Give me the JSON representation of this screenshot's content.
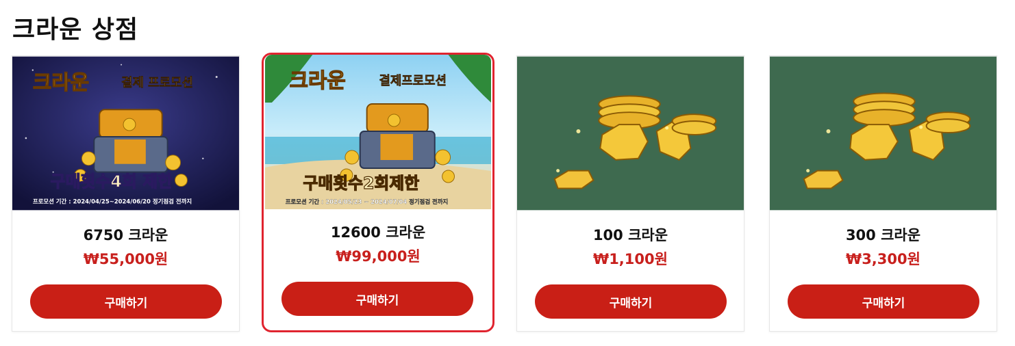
{
  "page": {
    "title": "크라운 상점"
  },
  "products": [
    {
      "name": "6750 크라운",
      "price": "₩55,000원",
      "buy_label": "구매하기",
      "banner": {
        "headline_a": "크라운",
        "headline_b": "결제 프로모션",
        "limit_text": "구매횟수4회 제한",
        "period": "프로모션 기간 : 2024/04/25~2024/06/20 정기점검 전까지",
        "theme": "night"
      }
    },
    {
      "name": "12600 크라운",
      "price": "₩99,000원",
      "buy_label": "구매하기",
      "selected": true,
      "banner": {
        "headline_a": "크라운",
        "headline_b": "결제프로모션",
        "limit_text": "구매횟수2회제한",
        "period": "프로모션 기간 : 2024/05/23 ~ 2024/07/04 정기점검 전까지",
        "theme": "beach"
      }
    },
    {
      "name": "100 크라운",
      "price": "₩1,100원",
      "buy_label": "구매하기",
      "banner": {
        "theme": "coins"
      }
    },
    {
      "name": "300 크라운",
      "price": "₩3,300원",
      "buy_label": "구매하기",
      "banner": {
        "theme": "coins"
      }
    }
  ],
  "colors": {
    "accent": "#c91f16",
    "price": "#c8201d",
    "selected_border": "#e0242f",
    "coin_bg": "#3e6a4f"
  }
}
